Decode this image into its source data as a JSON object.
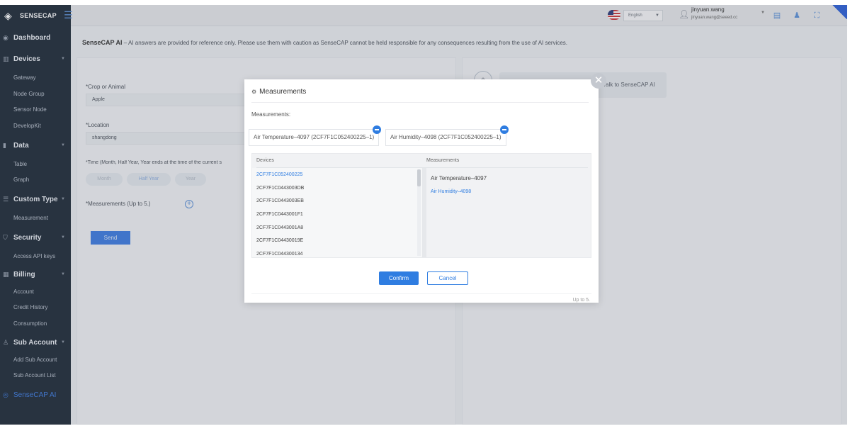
{
  "topbar": {
    "logo_text": "SENSECAP",
    "language": "English",
    "user_name": "jinyuan.wang",
    "user_email": "jinyuan.wang@seeed.cc"
  },
  "sidebar": {
    "sections": [
      {
        "label": "Dashboard",
        "icon": "dashboard-icon"
      },
      {
        "label": "Devices",
        "icon": "devices-icon",
        "items": [
          "Gateway",
          "Node Group",
          "Sensor Node",
          "DevelopKit"
        ]
      },
      {
        "label": "Data",
        "icon": "chart-icon",
        "items": [
          "Table",
          "Graph"
        ]
      },
      {
        "label": "Custom Type",
        "icon": "custom-type-icon",
        "items": [
          "Measurement"
        ]
      },
      {
        "label": "Security",
        "icon": "shield-icon",
        "items": [
          "Access API keys"
        ]
      },
      {
        "label": "Billing",
        "icon": "billing-icon",
        "items": [
          "Account",
          "Credit History",
          "Consumption"
        ]
      },
      {
        "label": "Sub Account",
        "icon": "user-icon",
        "items": [
          "Add Sub Account",
          "Sub Account List"
        ]
      },
      {
        "label": "SenseCAP AI",
        "icon": "ai-icon"
      }
    ]
  },
  "disclaimer": {
    "title": "SenseCAP AI",
    "text": " – AI answers are provided for reference only. Please use them with caution as SenseCAP cannot be held responsible for any consequences resulting from the use of AI services."
  },
  "form": {
    "crop_label": "*Crop or Animal",
    "crop_value": "Apple",
    "location_label": "*Location",
    "location_value": "shangdong",
    "time_label": "*Time (Month, Half Year, Year ends at the time of the current s",
    "time_options": [
      "Month",
      "Half Year",
      "Year"
    ],
    "measurements_label": "*Measurements (Up to 5.)",
    "send_label": "Send"
  },
  "chat": {
    "prompt": "Talk to SenseCAP AI"
  },
  "modal": {
    "title": "Measurements",
    "measurements_label": "Measurements:",
    "selected_chips": [
      "Air Temperature–4097 (2CF7F1C052400225–1)",
      "Air Humidity–4098 (2CF7F1C052400225–1)"
    ],
    "devices_header": "Devices",
    "measurements_header": "Measurements",
    "devices": [
      "2CF7F1C052400225",
      "2CF7F1C0443003DB",
      "2CF7F1C0443003EB",
      "2CF7F1C0443001F1",
      "2CF7F1C0443001A8",
      "2CF7F1C04430019E",
      "2CF7F1C044300134"
    ],
    "selected_device_index": 0,
    "measurements": [
      "Air Temperature–4097",
      "Air Humidity–4098"
    ],
    "selected_measurement_index": 1,
    "confirm_label": "Confirm",
    "cancel_label": "Cancel",
    "limit_note": "Up to 5."
  },
  "colors": {
    "accent": "#2f7de1",
    "sidebar_bg": "#1e2a38"
  }
}
